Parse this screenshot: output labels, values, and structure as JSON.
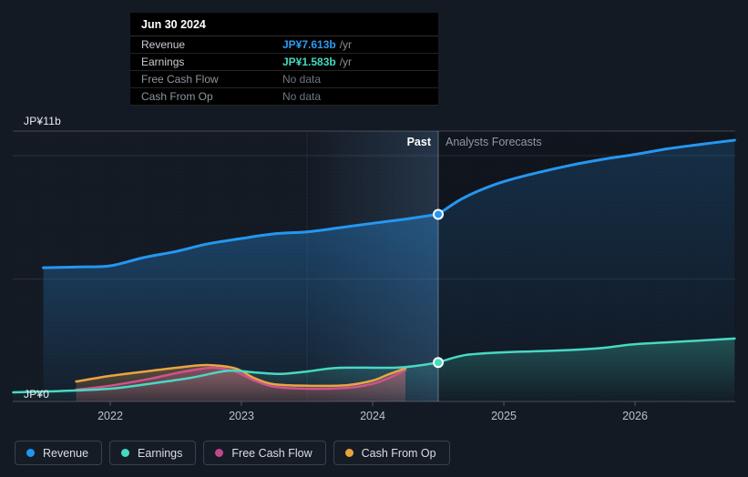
{
  "tooltip": {
    "date": "Jun 30 2024",
    "rows": [
      {
        "label": "Revenue",
        "value": "JP¥7.613b",
        "unit": "/yr",
        "value_color": "#2e9bf0",
        "has_data": true
      },
      {
        "label": "Earnings",
        "value": "JP¥1.583b",
        "unit": "/yr",
        "value_color": "#46d8c0",
        "has_data": true
      },
      {
        "label": "Free Cash Flow",
        "value": "No data",
        "unit": "",
        "value_color": "#6f7780",
        "has_data": false
      },
      {
        "label": "Cash From Op",
        "value": "No data",
        "unit": "",
        "value_color": "#6f7780",
        "has_data": false
      }
    ]
  },
  "labels": {
    "past": "Past",
    "forecast": "Analysts Forecasts",
    "y_max": "JP¥11b",
    "y_min": "JP¥0"
  },
  "legend": {
    "items": [
      {
        "label": "Revenue",
        "color": "#2196f3"
      },
      {
        "label": "Earnings",
        "color": "#45d9c2"
      },
      {
        "label": "Free Cash Flow",
        "color": "#c2478d"
      },
      {
        "label": "Cash From Op",
        "color": "#e8a33d"
      }
    ]
  },
  "chart_data": {
    "type": "line",
    "title": "Earnings and Revenue Growth with Analyst Forecasts",
    "x_unit": "year",
    "x_range": [
      2021.26,
      2026.76
    ],
    "ylim": [
      0,
      11
    ],
    "y_unit": "JP¥ billions per year",
    "x_ticks": [
      "2022",
      "2023",
      "2024",
      "2025",
      "2026"
    ],
    "divider_x": 2024.5,
    "divider_label": "Jun 30 2024",
    "grid": [
      "0",
      "5.5b",
      "10b",
      "11b"
    ],
    "legend_position": "bottom",
    "series": [
      {
        "key": "revenue",
        "name": "Revenue",
        "color": "#2597f0",
        "past": [
          [
            2021.49,
            5.44
          ],
          [
            2021.75,
            5.47
          ],
          [
            2022.0,
            5.52
          ],
          [
            2022.25,
            5.85
          ],
          [
            2022.5,
            6.1
          ],
          [
            2022.75,
            6.42
          ],
          [
            2023.0,
            6.63
          ],
          [
            2023.25,
            6.82
          ],
          [
            2023.5,
            6.9
          ],
          [
            2023.75,
            7.07
          ],
          [
            2024.0,
            7.25
          ],
          [
            2024.25,
            7.42
          ],
          [
            2024.5,
            7.613
          ]
        ],
        "forecast": [
          [
            2024.5,
            7.613
          ],
          [
            2024.65,
            8.15
          ],
          [
            2024.8,
            8.55
          ],
          [
            2025.0,
            8.95
          ],
          [
            2025.25,
            9.3
          ],
          [
            2025.5,
            9.6
          ],
          [
            2025.75,
            9.85
          ],
          [
            2026.0,
            10.05
          ],
          [
            2026.25,
            10.28
          ],
          [
            2026.5,
            10.46
          ],
          [
            2026.76,
            10.63
          ]
        ]
      },
      {
        "key": "earnings",
        "name": "Earnings",
        "color": "#48d9c2",
        "past": [
          [
            2021.26,
            0.37
          ],
          [
            2021.6,
            0.42
          ],
          [
            2022.0,
            0.52
          ],
          [
            2022.3,
            0.72
          ],
          [
            2022.6,
            0.95
          ],
          [
            2022.9,
            1.25
          ],
          [
            2023.1,
            1.18
          ],
          [
            2023.3,
            1.12
          ],
          [
            2023.5,
            1.22
          ],
          [
            2023.75,
            1.37
          ],
          [
            2024.2,
            1.38
          ],
          [
            2024.5,
            1.583
          ]
        ],
        "forecast": [
          [
            2024.5,
            1.583
          ],
          [
            2024.7,
            1.88
          ],
          [
            2025.0,
            2.0
          ],
          [
            2025.3,
            2.05
          ],
          [
            2025.7,
            2.15
          ],
          [
            2026.0,
            2.33
          ],
          [
            2026.4,
            2.45
          ],
          [
            2026.76,
            2.56
          ]
        ]
      },
      {
        "key": "free_cash_flow",
        "name": "Free Cash Flow",
        "color": "#cf5290",
        "past": [
          [
            2021.74,
            0.48
          ],
          [
            2022.0,
            0.64
          ],
          [
            2022.3,
            0.92
          ],
          [
            2022.55,
            1.2
          ],
          [
            2022.78,
            1.37
          ],
          [
            2022.95,
            1.22
          ],
          [
            2023.1,
            0.85
          ],
          [
            2023.25,
            0.6
          ],
          [
            2023.5,
            0.52
          ],
          [
            2023.8,
            0.55
          ],
          [
            2024.0,
            0.72
          ],
          [
            2024.12,
            0.95
          ],
          [
            2024.25,
            1.27
          ]
        ]
      },
      {
        "key": "cash_from_op",
        "name": "Cash From Op",
        "color": "#eba442",
        "past": [
          [
            2021.74,
            0.81
          ],
          [
            2022.0,
            1.04
          ],
          [
            2022.3,
            1.24
          ],
          [
            2022.55,
            1.4
          ],
          [
            2022.74,
            1.48
          ],
          [
            2022.95,
            1.35
          ],
          [
            2023.1,
            0.95
          ],
          [
            2023.25,
            0.7
          ],
          [
            2023.5,
            0.64
          ],
          [
            2023.8,
            0.66
          ],
          [
            2024.0,
            0.85
          ],
          [
            2024.12,
            1.1
          ],
          [
            2024.25,
            1.35
          ]
        ]
      }
    ]
  },
  "colors": {
    "background": "#141a24",
    "tooltip_bg": "#000000",
    "revenue": "#2597f0",
    "earnings": "#48d9c2",
    "free_cash_flow": "#cf5290",
    "cash_from_op": "#eba442",
    "forecast_text": "#8e99a5"
  }
}
